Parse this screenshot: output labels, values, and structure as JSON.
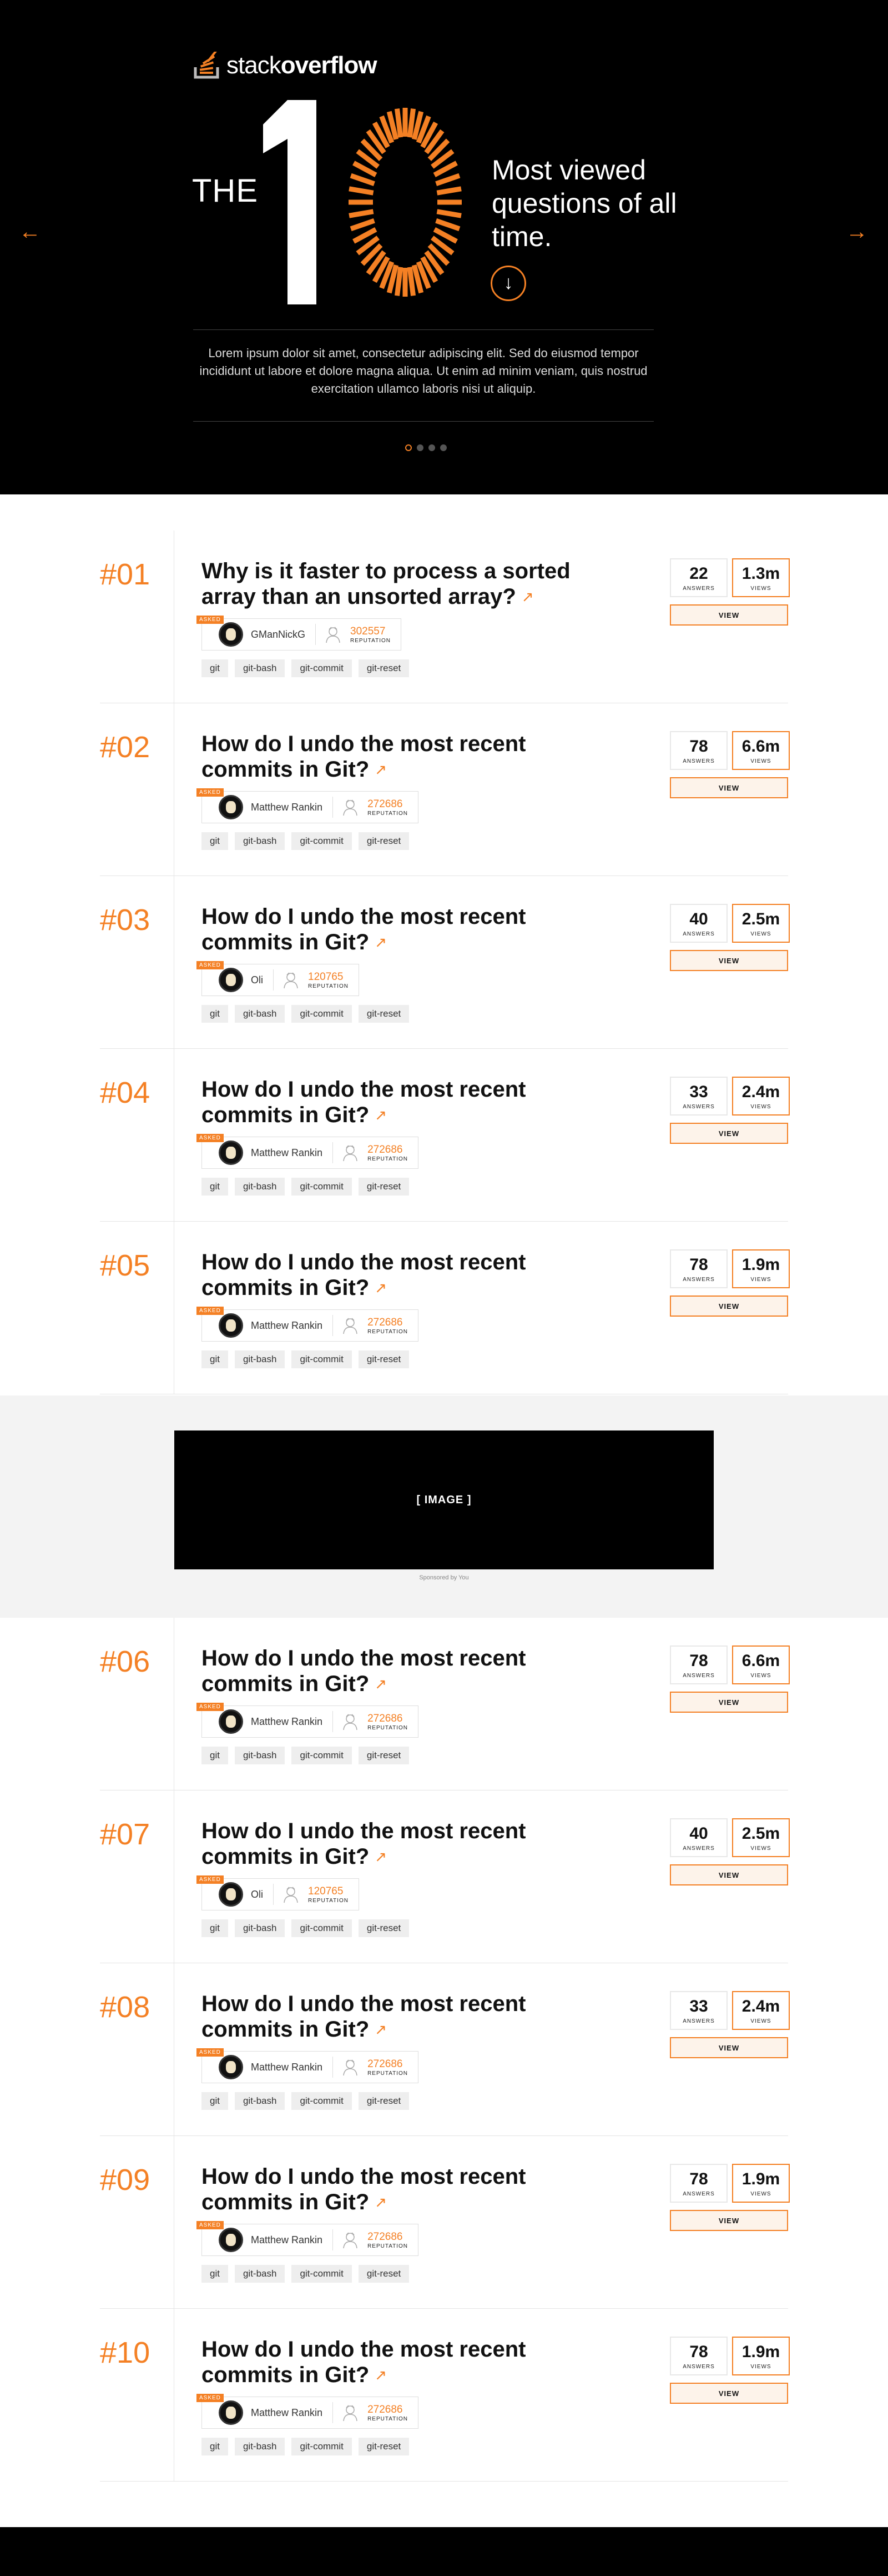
{
  "brand": {
    "name_light": "stack",
    "name_bold": "overflow",
    "accent": "#f48024"
  },
  "hero": {
    "the": "THE",
    "heading": "Most viewed questions of all time.",
    "description": "Lorem ipsum dolor sit amet, consectetur adipiscing elit. Sed do eiusmod tempor incididunt ut labore et dolore magna aliqua. Ut enim ad minim veniam, quis nostrud exercitation ullamco laboris nisi ut aliquip.",
    "down_arrow": "↓",
    "prev_arrow": "←",
    "next_arrow": "→",
    "slides_count": 4,
    "active_slide": 1
  },
  "labels": {
    "asker_badge": "ASKED",
    "reputation": "REPUTATION",
    "answers": "ANSWERS",
    "views": "VIEWS",
    "view_button": "VIEW",
    "external_icon": "↗"
  },
  "questions": [
    {
      "rank": "#01",
      "title": "Why is it faster to process a sorted array than an unsorted array?",
      "author": "GManNickG",
      "reputation": "302557",
      "answers": "22",
      "views": "1.3m",
      "tags": [
        "git",
        "git-bash",
        "git-commit",
        "git-reset"
      ]
    },
    {
      "rank": "#02",
      "title": "How do I undo the most recent commits in Git?",
      "author": "Matthew Rankin",
      "reputation": "272686",
      "answers": "78",
      "views": "6.6m",
      "tags": [
        "git",
        "git-bash",
        "git-commit",
        "git-reset"
      ]
    },
    {
      "rank": "#03",
      "title": "How do I undo the most recent commits in Git?",
      "author": "Oli",
      "reputation": "120765",
      "answers": "40",
      "views": "2.5m",
      "tags": [
        "git",
        "git-bash",
        "git-commit",
        "git-reset"
      ]
    },
    {
      "rank": "#04",
      "title": "How do I undo the most recent commits in Git?",
      "author": "Matthew Rankin",
      "reputation": "272686",
      "answers": "33",
      "views": "2.4m",
      "tags": [
        "git",
        "git-bash",
        "git-commit",
        "git-reset"
      ]
    },
    {
      "rank": "#05",
      "title": "How do I undo the most recent commits in Git?",
      "author": "Matthew Rankin",
      "reputation": "272686",
      "answers": "78",
      "views": "1.9m",
      "tags": [
        "git",
        "git-bash",
        "git-commit",
        "git-reset"
      ]
    },
    {
      "rank": "#06",
      "title": "How do I undo the most recent commits in Git?",
      "author": "Matthew Rankin",
      "reputation": "272686",
      "answers": "78",
      "views": "6.6m",
      "tags": [
        "git",
        "git-bash",
        "git-commit",
        "git-reset"
      ]
    },
    {
      "rank": "#07",
      "title": "How do I undo the most recent commits in Git?",
      "author": "Oli",
      "reputation": "120765",
      "answers": "40",
      "views": "2.5m",
      "tags": [
        "git",
        "git-bash",
        "git-commit",
        "git-reset"
      ]
    },
    {
      "rank": "#08",
      "title": "How do I undo the most recent commits in Git?",
      "author": "Matthew Rankin",
      "reputation": "272686",
      "answers": "33",
      "views": "2.4m",
      "tags": [
        "git",
        "git-bash",
        "git-commit",
        "git-reset"
      ]
    },
    {
      "rank": "#09",
      "title": "How do I undo the most recent commits in Git?",
      "author": "Matthew Rankin",
      "reputation": "272686",
      "answers": "78",
      "views": "1.9m",
      "tags": [
        "git",
        "git-bash",
        "git-commit",
        "git-reset"
      ]
    },
    {
      "rank": "#10",
      "title": "How do I undo the most recent commits in Git?",
      "author": "Matthew Rankin",
      "reputation": "272686",
      "answers": "78",
      "views": "1.9m",
      "tags": [
        "git",
        "git-bash",
        "git-commit",
        "git-reset"
      ]
    }
  ],
  "ad": {
    "image_label": "[ IMAGE ]",
    "caption": "Sponsored by You"
  }
}
